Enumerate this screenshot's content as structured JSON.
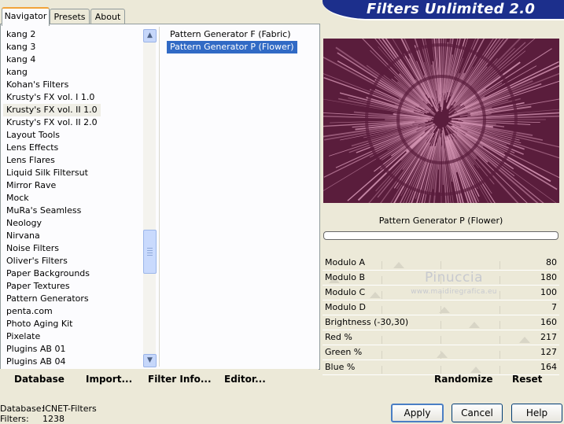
{
  "banner": {
    "title": "Filters Unlimited 2.0"
  },
  "tabs": [
    "Navigator",
    "Presets",
    "About"
  ],
  "categories": [
    "kang 2",
    "kang 3",
    "kang 4",
    "kang",
    "Kohan's Filters",
    "Krusty's FX vol. I 1.0",
    "Krusty's FX vol. II 1.0",
    "Krusty's FX vol. II 2.0",
    "Layout Tools",
    "Lens Effects",
    "Lens Flares",
    "Liquid Silk Filtersut",
    "Mirror Rave",
    "Mock",
    "MuRa's Seamless",
    "Neology",
    "Nirvana",
    "Noise Filters",
    "Oliver's Filters",
    "Paper Backgrounds",
    "Paper Textures",
    "Pattern Generators",
    "penta.com",
    "Photo Aging Kit",
    "Pixelate",
    "Plugins AB 01",
    "Plugins AB 04"
  ],
  "selected_category": "Krusty's FX vol. II 1.0",
  "filters": [
    "Pattern Generator F (Fabric)",
    "Pattern Generator P (Flower)"
  ],
  "selected_filter": "Pattern Generator P (Flower)",
  "preview": {
    "filter_name": "Pattern Generator P (Flower)",
    "colors": {
      "dark": "#5a1d3c",
      "light": "#d99ab8"
    }
  },
  "params": [
    {
      "name": "Modulo A",
      "value": "80"
    },
    {
      "name": "Modulo B",
      "value": "180"
    },
    {
      "name": "Modulo C",
      "value": "100"
    },
    {
      "name": "Modulo D",
      "value": "7"
    },
    {
      "name": "Brightness (-30,30)",
      "value": "160"
    },
    {
      "name": "Red %",
      "value": "217"
    },
    {
      "name": "Green %",
      "value": "127"
    },
    {
      "name": "Blue %",
      "value": "164"
    }
  ],
  "toolbar": {
    "database": "Database",
    "import": "Import...",
    "filter_info": "Filter Info...",
    "editor": "Editor...",
    "randomize": "Randomize",
    "reset": "Reset"
  },
  "footer": {
    "database_label": "Database:",
    "database_value": "ICNET-Filters",
    "filters_label": "Filters:",
    "filters_value": "1238"
  },
  "buttons": {
    "apply": "Apply",
    "cancel": "Cancel",
    "help": "Help"
  },
  "watermark": {
    "line1": "Pinuccia",
    "line2": "www.maidiregrafica.eu"
  }
}
